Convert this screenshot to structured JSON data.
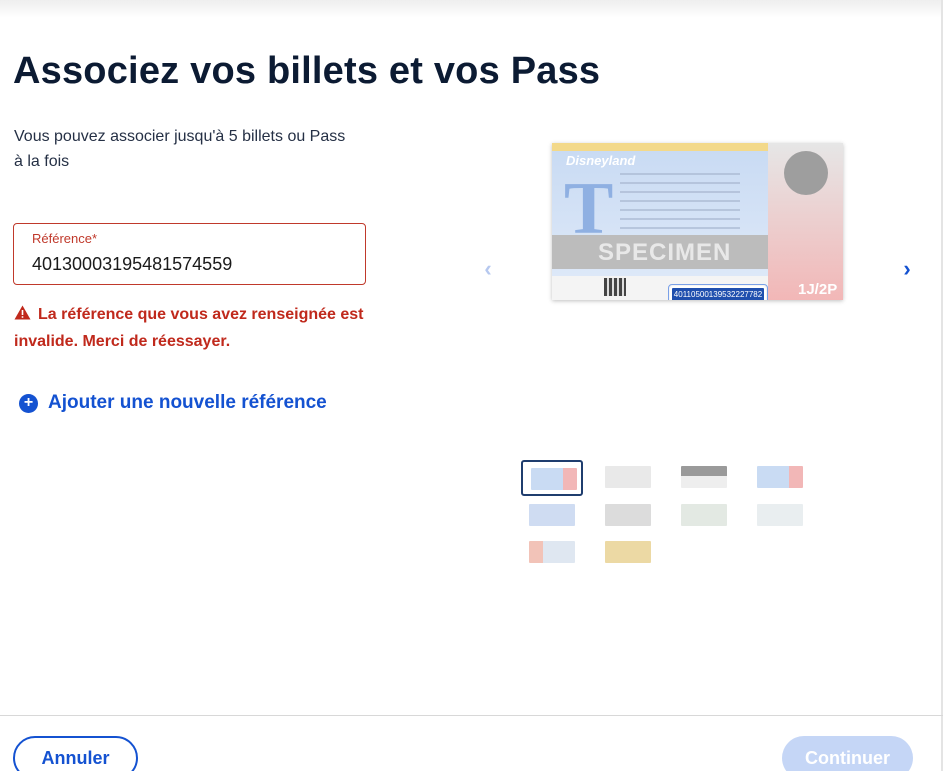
{
  "page": {
    "title": "Associez vos billets et vos Pass",
    "subtitle": "Vous pouvez associer jusqu'à 5 billets ou Pass à la fois"
  },
  "form": {
    "reference_label": "Référence*",
    "reference_value": "40130003195481574559",
    "error_message": "La référence que vous avez renseignée est invalide. Merci de réessayer.",
    "add_reference_label": "Ajouter une nouvelle référence"
  },
  "illustration": {
    "brand": "Disneyland",
    "specimen_text": "SPECIMEN",
    "highlighted_code": "40110500139532227782",
    "days_label": "1J/2P",
    "thumbnail_count": 10,
    "selected_thumbnail": 1
  },
  "actions": {
    "cancel_label": "Annuler",
    "continue_label": "Continuer"
  },
  "colors": {
    "primary": "#1452d1",
    "error": "#c0291c",
    "title": "#0c1b33",
    "disabled_button": "#c5d6f6"
  },
  "icons": {
    "error": "warning-triangle-icon",
    "add": "plus-circle-icon",
    "prev": "chevron-left-icon",
    "next": "chevron-right-icon"
  }
}
